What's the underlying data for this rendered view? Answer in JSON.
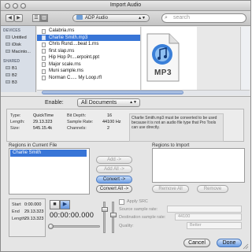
{
  "window": {
    "title": "Import Audio"
  },
  "toolbar": {
    "back_icon": "chevron-left-icon",
    "forward_icon": "chevron-right-icon",
    "current_folder": "ADP Audio",
    "search_placeholder": "search"
  },
  "sidebar": {
    "devices_header": "DEVICES",
    "devices": [
      "Untitled",
      "iDisk",
      "Macinto..."
    ],
    "shared_header": "SHARED",
    "shared": [
      "B1",
      "B2",
      "B3"
    ]
  },
  "files": {
    "items": [
      {
        "name": "Calabria.rns",
        "selected": false
      },
      {
        "name": "Charlie Smith.mp3",
        "selected": true
      },
      {
        "name": "Chris Rund....beat 1.rns",
        "selected": false
      },
      {
        "name": "first slap.rns",
        "selected": false
      },
      {
        "name": "Hip Hop Pr....erpoint.ppt",
        "selected": false
      },
      {
        "name": "Major scale.rns",
        "selected": false
      },
      {
        "name": "Muni sample.rns",
        "selected": false
      },
      {
        "name": "Norman C..... My Loop.rfl",
        "selected": false
      }
    ],
    "preview_type": "MP3"
  },
  "enable": {
    "label": "Enable:",
    "value": "All Documents"
  },
  "file_info": {
    "type_label": "Type:",
    "type_value": "QuickTime",
    "length_label": "Length:",
    "length_value": "29.13.323",
    "size_label": "Size:",
    "size_value": "545.15.4k",
    "bitdepth_label": "Bit Depth:",
    "bitdepth_value": "16",
    "samplerate_label": "Sample Rate:",
    "samplerate_value": "44100 Hz",
    "channels_label": "Channels:",
    "channels_value": "2",
    "note": "Charlie Smith.mp3 must be converted to be used because it is not an audio file type that Pro Tools can use directly."
  },
  "regions": {
    "current_label": "Regions in Current File",
    "current_items": [
      "Charlie Smith"
    ],
    "import_label": "Regions to Import",
    "add_label": "Add ->",
    "add_all_label": "Add All ->",
    "convert_label": "Convert ->",
    "convert_all_label": "Convert All ->",
    "remove_all_label": "Remove All",
    "remove_label": "Remove"
  },
  "preview": {
    "start_label": "Start",
    "start_value": "0:00.000",
    "end_label": "End",
    "end_value": "29.13.323",
    "length_label": "Length",
    "length_value": "29.13.323",
    "clock": "00:00:00.000",
    "volume_level": 0.8,
    "speed_level": 0.6,
    "scrub_position": 0.0
  },
  "src": {
    "apply_label": "Apply SRC",
    "source_rate_label": "Source sample rate:",
    "destination_rate_label": "Destination sample rate:",
    "destination_rate_value": "44100",
    "quality_label": "Quality:",
    "quality_value": "Better"
  },
  "buttons": {
    "cancel": "Cancel",
    "done": "Done"
  },
  "colors": {
    "selection": "#3875d7",
    "window_bg": "#e8e8e8",
    "sidebar_bg": "#d8dee7"
  }
}
